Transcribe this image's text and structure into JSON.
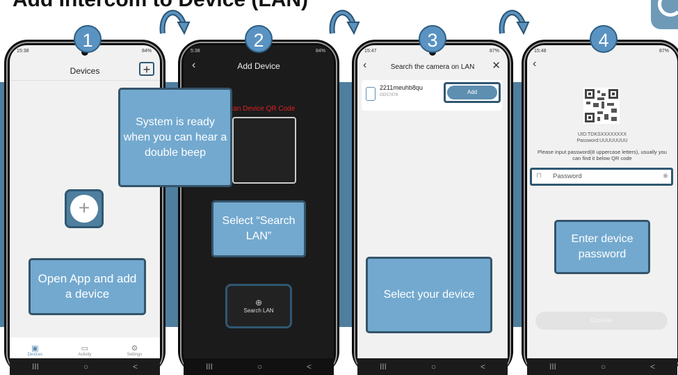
{
  "title": "Add Intercom to Device (LAN)",
  "colors": {
    "band": "#4f7f9e",
    "callout": "#73a9cf",
    "badge": "#5a93c2",
    "add_button": "#5e8eb0"
  },
  "steps": [
    {
      "number": "1",
      "time": "15:38",
      "status": "84%",
      "header": "Devices",
      "add_icon": "+",
      "callout": "Open App and add a device",
      "tabs": [
        {
          "label": "Devices",
          "icon": "device-icon"
        },
        {
          "label": "Activity",
          "icon": "chat-icon"
        },
        {
          "label": "Settings",
          "icon": "gear-icon"
        }
      ]
    },
    {
      "number": "2",
      "time": "5:38",
      "status": "84%",
      "header": "Add Device",
      "scan_label": "Scan Device QR Code",
      "info_callout": "System is ready when you can hear a double beep",
      "callout": "Select “Search LAN”",
      "search_lan": "Search LAN"
    },
    {
      "number": "3",
      "time": "15:47",
      "status": "87%",
      "header": "Search the camera on LAN",
      "device_name": "2211meuhb8qu",
      "device_model": "ODS7878",
      "add_label": "Add",
      "callout": "Select your device"
    },
    {
      "number": "4",
      "time": "15:48",
      "status": "87%",
      "uid": "UID:TDKSXXXXXXXX",
      "password_line": "Password:UUUUUUUU",
      "instruction": "Please input password(8 uppercase letters), usually you can find it below QR code",
      "password_placeholder": "Password",
      "continue": "Continue",
      "callout": "Enter device password"
    }
  ],
  "nav": {
    "recent": "III",
    "home": "○",
    "back": "<"
  }
}
